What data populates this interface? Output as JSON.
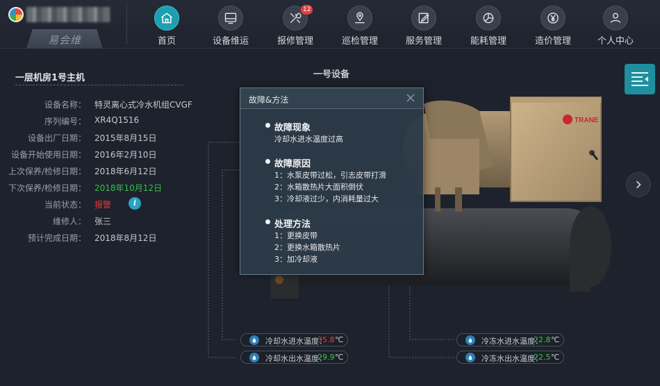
{
  "brand": {
    "sub_name": "易会维"
  },
  "nav": {
    "items": [
      {
        "label": "首页",
        "icon": "home-icon",
        "active": true
      },
      {
        "label": "设备维运",
        "icon": "monitor-icon"
      },
      {
        "label": "报修管理",
        "icon": "tools-icon",
        "badge": "12"
      },
      {
        "label": "巡检管理",
        "icon": "location-pin-icon"
      },
      {
        "label": "服务管理",
        "icon": "edit-icon"
      },
      {
        "label": "能耗管理",
        "icon": "pie-chart-icon"
      },
      {
        "label": "造价管理",
        "icon": "yen-icon"
      },
      {
        "label": "个人中心",
        "icon": "user-icon"
      }
    ]
  },
  "info": {
    "title": "一层机房1号主机",
    "rows": [
      {
        "label": "设备名称：",
        "value": "特灵离心式冷水机组CVGF"
      },
      {
        "label": "序列编号：",
        "value": "XR4Q1516"
      },
      {
        "label": "设备出厂日期：",
        "value": "2015年8月15日"
      },
      {
        "label": "设备开始使用日期：",
        "value": "2016年2月10日"
      },
      {
        "label": "上次保养/检修日期：",
        "value": "2018年6月12日"
      },
      {
        "label": "下次保养/检修日期：",
        "value": "2018年10月12日",
        "color": "green"
      },
      {
        "label": "当前状态：",
        "value": "报警",
        "color": "red"
      },
      {
        "label": "维修人：",
        "value": "张三"
      },
      {
        "label": "预计完成日期：",
        "value": "2018年8月12日"
      }
    ],
    "info_icon": "i"
  },
  "equipment": {
    "title": "一号设备",
    "brand_label": "TRANE"
  },
  "sensors": [
    {
      "label": "冷却水进水温度：",
      "value": "35.8",
      "unit": "℃",
      "color": "red"
    },
    {
      "label": "冷却水出水温度：",
      "value": "29.9",
      "unit": "℃",
      "color": "green"
    },
    {
      "label": "冷冻水进水温度：",
      "value": "22.8",
      "unit": "℃",
      "color": "green"
    },
    {
      "label": "冷冻水出水温度：",
      "value": "22.5",
      "unit": "℃",
      "color": "green"
    }
  ],
  "dialog": {
    "title": "故障&方法",
    "sections": [
      {
        "heading": "故障现象",
        "lines": [
          "冷却水进水温度过高"
        ]
      },
      {
        "heading": "故障原因",
        "lines": [
          "1：水泵皮带过松，引志皮带打滑",
          "2：水箱散热片大面积倒伏",
          "3：冷却液过少，内消耗量过大"
        ]
      },
      {
        "heading": "处理方法",
        "lines": [
          "1：更换皮带",
          "2：更换水箱散热片",
          "3：加冷却液"
        ]
      }
    ]
  },
  "colors": {
    "accent": "#1e9fb1",
    "alarm": "#e03b3b",
    "ok": "#36c24a",
    "background": "#1d222c"
  }
}
